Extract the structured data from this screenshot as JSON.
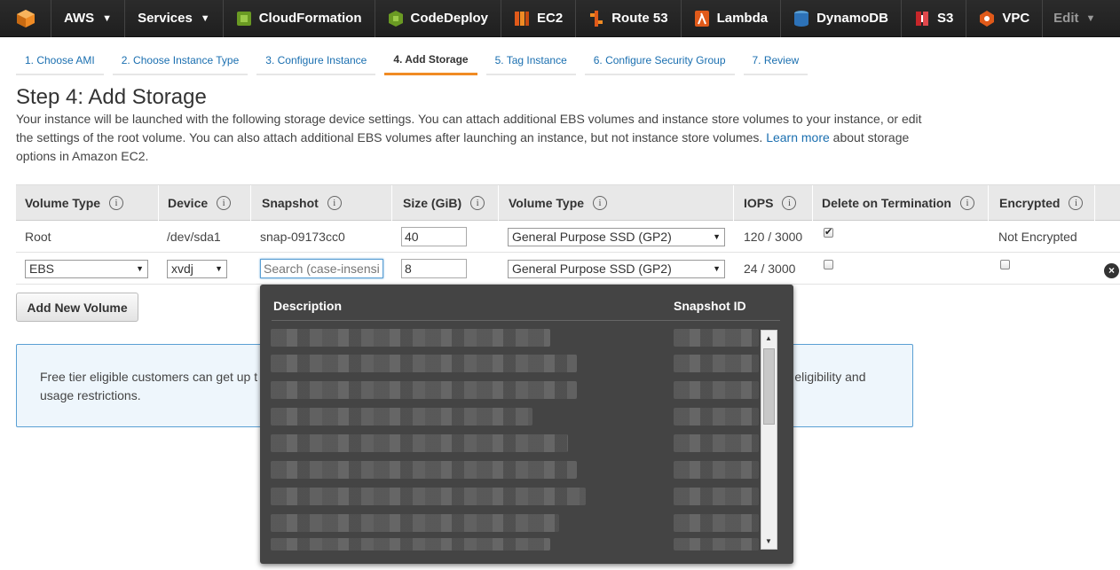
{
  "nav": {
    "aws_label": "AWS",
    "services_label": "Services",
    "shortcuts": [
      {
        "label": "CloudFormation",
        "icon": "cloudformation-icon",
        "color": "#6a9a23"
      },
      {
        "label": "CodeDeploy",
        "icon": "codedeploy-icon",
        "color": "#6a9a23"
      },
      {
        "label": "EC2",
        "icon": "ec2-icon",
        "color": "#e05a1a"
      },
      {
        "label": "Route 53",
        "icon": "route53-icon",
        "color": "#e05a1a"
      },
      {
        "label": "Lambda",
        "icon": "lambda-icon",
        "color": "#e05a1a"
      },
      {
        "label": "DynamoDB",
        "icon": "dynamodb-icon",
        "color": "#2d72b8"
      },
      {
        "label": "S3",
        "icon": "s3-icon",
        "color": "#c7262a"
      },
      {
        "label": "VPC",
        "icon": "vpc-icon",
        "color": "#e05a1a"
      }
    ],
    "edit_label": "Edit"
  },
  "wizard": {
    "steps": [
      "1. Choose AMI",
      "2. Choose Instance Type",
      "3. Configure Instance",
      "4. Add Storage",
      "5. Tag Instance",
      "6. Configure Security Group",
      "7. Review"
    ],
    "active": "4. Add Storage"
  },
  "page": {
    "title": "Step 4: Add Storage",
    "intro_part1": "Your instance will be launched with the following storage device settings. You can attach additional EBS volumes and instance store volumes to your instance, or edit the settings of the root volume. You can also attach additional EBS volumes after launching an instance, but not instance store volumes.",
    "learn_more": "Learn more",
    "intro_part2": "about storage options in Amazon EC2."
  },
  "table": {
    "headers": {
      "volume_type": "Volume Type",
      "device": "Device",
      "snapshot": "Snapshot",
      "size": "Size (GiB)",
      "volume_type2": "Volume Type",
      "iops": "IOPS",
      "delete": "Delete on Termination",
      "encrypted": "Encrypted"
    },
    "rows": [
      {
        "volume_type": "Root",
        "device": "/dev/sda1",
        "snapshot": "snap-09173cc0",
        "size": "40",
        "disk_type": "General Purpose SSD (GP2)",
        "iops": "120 / 3000",
        "delete_on_termination": true,
        "encrypted": "Not Encrypted"
      },
      {
        "volume_type": "EBS",
        "device": "xvdj",
        "snapshot_placeholder": "Search (case-insensi",
        "size": "8",
        "disk_type": "General Purpose SSD (GP2)",
        "iops": "24 / 3000",
        "delete_on_termination": false,
        "encrypted": false
      }
    ]
  },
  "add_button": "Add New Volume",
  "notice": {
    "line1_start": "Free tier eligible customers can get up t",
    "line1_end": "er eligibility and",
    "line2": "usage restrictions."
  },
  "snapshot_dropdown": {
    "col_description": "Description",
    "col_snapshot_id": "Snapshot ID"
  },
  "colors": {
    "nav_bg": "#232323",
    "accent_tab": "#f08b24",
    "link": "#1a6fb0",
    "popup_bg": "#444444",
    "notice_border": "#5a9fd4"
  }
}
